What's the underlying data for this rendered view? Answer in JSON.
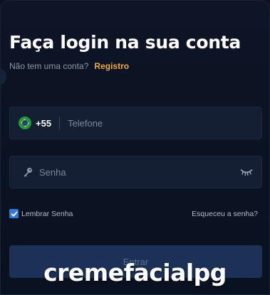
{
  "login": {
    "title": "Faça login na sua conta",
    "no_account_text": "Não tem uma conta?",
    "register_link": "Registro",
    "phone": {
      "flag_icon": "brazil-flag-icon",
      "country_code": "+55",
      "placeholder": "Telefone",
      "value": ""
    },
    "password": {
      "key_icon": "key-icon",
      "placeholder": "Senha",
      "value": "",
      "toggle_icon": "eye-closed-icon"
    },
    "remember_label": "Lembrar Senha",
    "remember_checked": true,
    "forgot_link": "Esqueceu a senha?",
    "submit_label": "Entrar"
  },
  "watermark": {
    "text": "cremefacialpg"
  },
  "colors": {
    "accent": "#f2a93b",
    "checkbox": "#2b7bdc",
    "field_bg": "#151f33",
    "button_bg": "#1b3157",
    "background": "#0b1322"
  }
}
